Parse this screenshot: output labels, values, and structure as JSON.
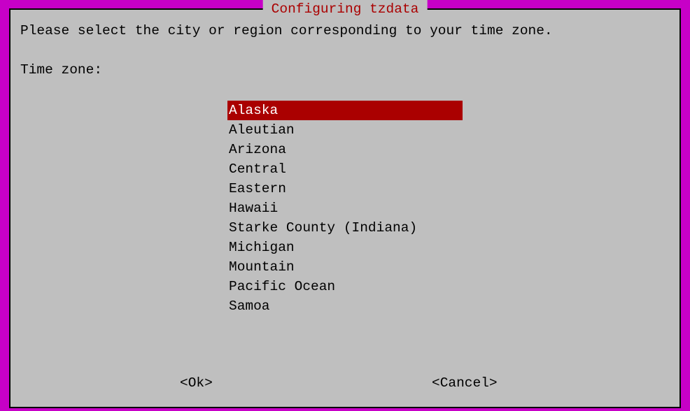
{
  "dialog": {
    "title": "Configuring tzdata",
    "prompt": "Please select the city or region corresponding to your time zone.",
    "label": "Time zone:",
    "selected_index": 0,
    "items": [
      "Alaska",
      "Aleutian",
      "Arizona",
      "Central",
      "Eastern",
      "Hawaii",
      "Starke County (Indiana)",
      "Michigan",
      "Mountain",
      "Pacific Ocean",
      "Samoa"
    ],
    "buttons": {
      "ok": "<Ok>",
      "cancel": "<Cancel>"
    }
  }
}
